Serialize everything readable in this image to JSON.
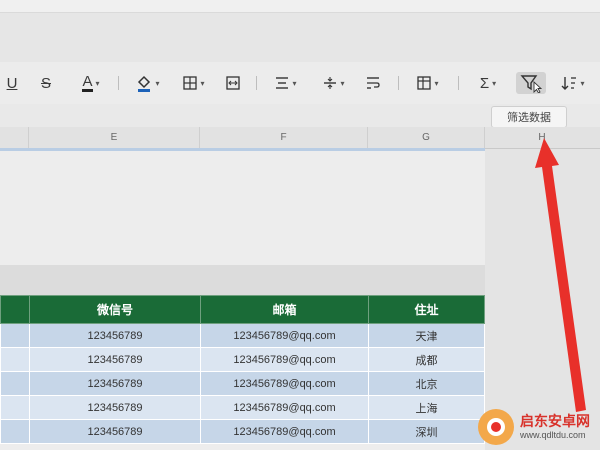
{
  "toolbar": {
    "underline": "U",
    "strikethrough": "S",
    "font_color": "A",
    "sum": "Σ"
  },
  "tooltip": "筛选数据",
  "columns": [
    "E",
    "F",
    "G",
    "H"
  ],
  "table": {
    "headers": [
      "微信号",
      "邮箱",
      "住址"
    ],
    "rows": [
      [
        "123456789",
        "123456789@qq.com",
        "天津"
      ],
      [
        "123456789",
        "123456789@qq.com",
        "成都"
      ],
      [
        "123456789",
        "123456789@qq.com",
        "北京"
      ],
      [
        "123456789",
        "123456789@qq.com",
        "上海"
      ],
      [
        "123456789",
        "123456789@qq.com",
        "深圳"
      ]
    ]
  },
  "watermark": {
    "name": "启东安卓网",
    "url": "www.qdltdu.com"
  },
  "colors": {
    "header_green": "#1a6b37",
    "row_blue": "#c6d6e8",
    "arrow_red": "#e8302a"
  }
}
